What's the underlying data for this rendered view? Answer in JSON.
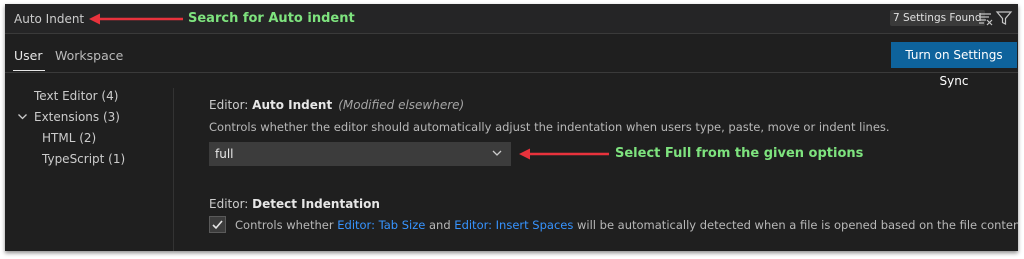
{
  "search": {
    "query": "Auto Indent",
    "result_count": "7 Settings Found",
    "icons": [
      "clear-filter-icon",
      "filter-icon"
    ]
  },
  "tabs": [
    {
      "label": "User",
      "active": true
    },
    {
      "label": "Workspace",
      "active": false
    }
  ],
  "sync_button": {
    "label": "Turn on Settings Sync",
    "color": "#0e639c"
  },
  "tree": {
    "items": [
      {
        "label": "Text Editor (4)"
      },
      {
        "label": "Extensions (3)",
        "expanded": true
      },
      {
        "label": "HTML (2)"
      },
      {
        "label": "TypeScript (1)"
      }
    ]
  },
  "settings": [
    {
      "category": "Editor: ",
      "name": "Auto Indent",
      "modified": "(Modified elsewhere)",
      "description": "Controls whether the editor should automatically adjust the indentation when users type, paste, move or indent lines.",
      "value": "full"
    },
    {
      "category": "Editor: ",
      "name": "Detect Indentation",
      "checked": true,
      "desc_parts": [
        "Controls whether ",
        "Editor: Tab Size",
        " and ",
        "Editor: Insert Spaces",
        " will be automatically detected when a file is opened based on the file contents."
      ]
    }
  ],
  "annotations": [
    {
      "text": "Search for Auto indent"
    },
    {
      "text": "Select Full from the given options"
    }
  ],
  "colors": {
    "arrow": "#e8323c",
    "annotation_text": "#7ee37e",
    "link": "#3794ff",
    "background": "#1f1f1f"
  }
}
